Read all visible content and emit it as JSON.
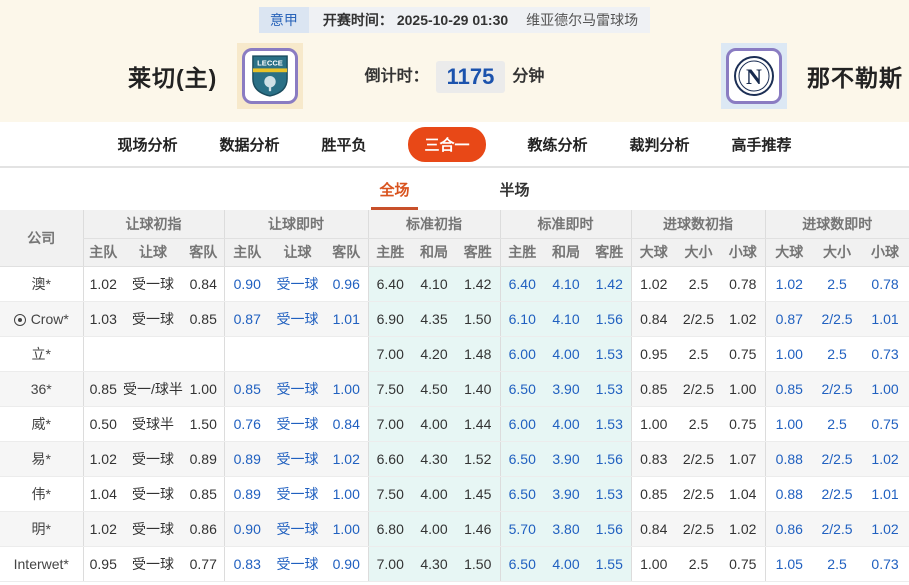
{
  "top_bar": {
    "league": "意甲",
    "kickoff_label": "开赛时间：",
    "kickoff_time": "2025-10-29 01:30",
    "venue": "维亚德尔马雷球场"
  },
  "match": {
    "home_name": "莱切(主)",
    "away_name": "那不勒斯",
    "home_logo": "lecce-crest",
    "away_logo": "napoli-crest",
    "countdown_label": "倒计时：",
    "countdown_value": "1175",
    "countdown_unit": "分钟"
  },
  "nav": {
    "tabs": [
      {
        "key": "scene-analysis",
        "label": "现场分析",
        "active": false
      },
      {
        "key": "data-analysis",
        "label": "数据分析",
        "active": false
      },
      {
        "key": "win-draw-lose",
        "label": "胜平负",
        "active": false
      },
      {
        "key": "three-in-one",
        "label": "三合一",
        "active": true
      },
      {
        "key": "coach-analysis",
        "label": "教练分析",
        "active": false
      },
      {
        "key": "referee-analysis",
        "label": "裁判分析",
        "active": false
      },
      {
        "key": "expert-picks",
        "label": "高手推荐",
        "active": false
      }
    ]
  },
  "sub_tabs": [
    {
      "key": "full-match",
      "label": "全场",
      "active": true
    },
    {
      "key": "half-match",
      "label": "半场",
      "active": false
    }
  ],
  "table": {
    "company_header": "公司",
    "groups": [
      {
        "label": "让球初指",
        "cols": [
          "主队",
          "让球",
          "客队"
        ]
      },
      {
        "label": "让球即时",
        "cols": [
          "主队",
          "让球",
          "客队"
        ]
      },
      {
        "label": "标准初指",
        "cols": [
          "主胜",
          "和局",
          "客胜"
        ]
      },
      {
        "label": "标准即时",
        "cols": [
          "主胜",
          "和局",
          "客胜"
        ]
      },
      {
        "label": "进球数初指",
        "cols": [
          "大球",
          "大小",
          "小球"
        ]
      },
      {
        "label": "进球数即时",
        "cols": [
          "大球",
          "大小",
          "小球"
        ]
      }
    ],
    "rows": [
      {
        "company": "澳*",
        "icon": false,
        "handicap_initial": [
          "1.02",
          "受一球",
          "0.84"
        ],
        "handicap_live": [
          "0.90",
          "受一球",
          "0.96"
        ],
        "standard_initial": [
          "6.40",
          "4.10",
          "1.42"
        ],
        "standard_live": [
          "6.40",
          "4.10",
          "1.42"
        ],
        "goals_initial": [
          "1.02",
          "2.5",
          "0.78"
        ],
        "goals_live": [
          "1.02",
          "2.5",
          "0.78"
        ]
      },
      {
        "company": "Crow*",
        "icon": true,
        "handicap_initial": [
          "1.03",
          "受一球",
          "0.85"
        ],
        "handicap_live": [
          "0.87",
          "受一球",
          "1.01"
        ],
        "standard_initial": [
          "6.90",
          "4.35",
          "1.50"
        ],
        "standard_live": [
          "6.10",
          "4.10",
          "1.56"
        ],
        "goals_initial": [
          "0.84",
          "2/2.5",
          "1.02"
        ],
        "goals_live": [
          "0.87",
          "2/2.5",
          "1.01"
        ]
      },
      {
        "company": "立*",
        "icon": false,
        "handicap_initial": [
          "",
          "",
          ""
        ],
        "handicap_live": [
          "",
          "",
          ""
        ],
        "standard_initial": [
          "7.00",
          "4.20",
          "1.48"
        ],
        "standard_live": [
          "6.00",
          "4.00",
          "1.53"
        ],
        "goals_initial": [
          "0.95",
          "2.5",
          "0.75"
        ],
        "goals_live": [
          "1.00",
          "2.5",
          "0.73"
        ]
      },
      {
        "company": "36*",
        "icon": false,
        "handicap_initial": [
          "0.85",
          "受一/球半",
          "1.00"
        ],
        "handicap_live": [
          "0.85",
          "受一球",
          "1.00"
        ],
        "standard_initial": [
          "7.50",
          "4.50",
          "1.40"
        ],
        "standard_live": [
          "6.50",
          "3.90",
          "1.53"
        ],
        "goals_initial": [
          "0.85",
          "2/2.5",
          "1.00"
        ],
        "goals_live": [
          "0.85",
          "2/2.5",
          "1.00"
        ]
      },
      {
        "company": "威*",
        "icon": false,
        "handicap_initial": [
          "0.50",
          "受球半",
          "1.50"
        ],
        "handicap_live": [
          "0.76",
          "受一球",
          "0.84"
        ],
        "standard_initial": [
          "7.00",
          "4.00",
          "1.44"
        ],
        "standard_live": [
          "6.00",
          "4.00",
          "1.53"
        ],
        "goals_initial": [
          "1.00",
          "2.5",
          "0.75"
        ],
        "goals_live": [
          "1.00",
          "2.5",
          "0.75"
        ]
      },
      {
        "company": "易*",
        "icon": false,
        "handicap_initial": [
          "1.02",
          "受一球",
          "0.89"
        ],
        "handicap_live": [
          "0.89",
          "受一球",
          "1.02"
        ],
        "standard_initial": [
          "6.60",
          "4.30",
          "1.52"
        ],
        "standard_live": [
          "6.50",
          "3.90",
          "1.56"
        ],
        "goals_initial": [
          "0.83",
          "2/2.5",
          "1.07"
        ],
        "goals_live": [
          "0.88",
          "2/2.5",
          "1.02"
        ]
      },
      {
        "company": "伟*",
        "icon": false,
        "handicap_initial": [
          "1.04",
          "受一球",
          "0.85"
        ],
        "handicap_live": [
          "0.89",
          "受一球",
          "1.00"
        ],
        "standard_initial": [
          "7.50",
          "4.00",
          "1.45"
        ],
        "standard_live": [
          "6.50",
          "3.90",
          "1.53"
        ],
        "goals_initial": [
          "0.85",
          "2/2.5",
          "1.04"
        ],
        "goals_live": [
          "0.88",
          "2/2.5",
          "1.01"
        ]
      },
      {
        "company": "明*",
        "icon": false,
        "handicap_initial": [
          "1.02",
          "受一球",
          "0.86"
        ],
        "handicap_live": [
          "0.90",
          "受一球",
          "1.00"
        ],
        "standard_initial": [
          "6.80",
          "4.00",
          "1.46"
        ],
        "standard_live": [
          "5.70",
          "3.80",
          "1.56"
        ],
        "goals_initial": [
          "0.84",
          "2/2.5",
          "1.02"
        ],
        "goals_live": [
          "0.86",
          "2/2.5",
          "1.02"
        ]
      },
      {
        "company": "Interwet*",
        "icon": false,
        "handicap_initial": [
          "0.95",
          "受一球",
          "0.77"
        ],
        "handicap_live": [
          "0.83",
          "受一球",
          "0.90"
        ],
        "standard_initial": [
          "7.00",
          "4.30",
          "1.50"
        ],
        "standard_live": [
          "6.50",
          "4.00",
          "1.55"
        ],
        "goals_initial": [
          "1.00",
          "2.5",
          "0.75"
        ],
        "goals_live": [
          "1.05",
          "2.5",
          "0.73"
        ]
      }
    ]
  },
  "colors": {
    "accent_orange": "#e84817",
    "subtab_orange": "#d9531e",
    "live_odds_blue": "#2060c0",
    "countdown_blue": "#1b52ad",
    "standard_section_bg": "#e7f6f4",
    "header_cream_bg": "#fcf7ea",
    "logo_border_purple": "#8a7cc2"
  }
}
